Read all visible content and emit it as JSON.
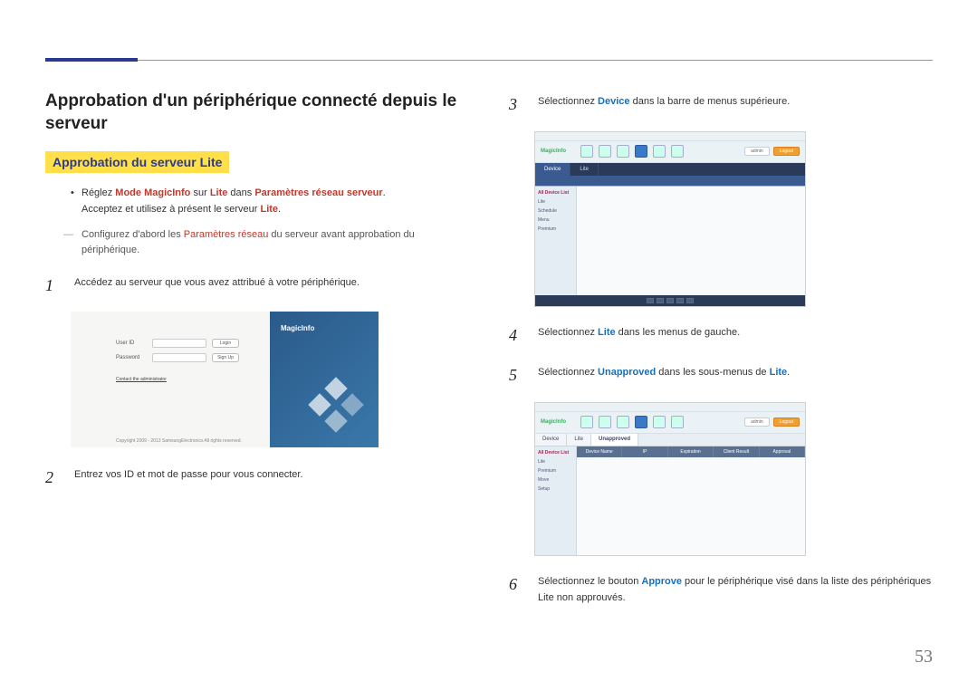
{
  "page_number": "53",
  "left": {
    "heading": "Approbation d'un périphérique connecté depuis le serveur",
    "sub_heading": "Approbation du serveur Lite",
    "bullet_pre": "Réglez ",
    "bullet_b1": "Mode MagicInfo",
    "bullet_mid1": " sur ",
    "bullet_b2": "Lite",
    "bullet_mid2": " dans ",
    "bullet_b3": "Paramètres réseau serveur",
    "bullet_post": ".",
    "bullet_line2a": "Acceptez et utilisez à présent le serveur ",
    "bullet_line2b": "Lite",
    "bullet_line2c": ".",
    "note_pre": "Configurez d'abord les ",
    "note_b": "Paramètres réseau",
    "note_post": " du serveur avant approbation du périphérique.",
    "step1": "Accédez au serveur que vous avez attribué à votre périphérique.",
    "step2": "Entrez vos ID et mot de passe pour vous connecter.",
    "login": {
      "user_id": "User ID",
      "password": "Password",
      "login_btn": "Login",
      "signup_btn": "Sign Up",
      "contact": "Contact the administrator",
      "brand": "MagicInfo",
      "copyright": "Copyright 2009 - 2013 SamsungElectronics  All rights reserved."
    }
  },
  "right": {
    "step3_pre": "Sélectionnez ",
    "step3_b": "Device",
    "step3_post": " dans la barre de menus supérieure.",
    "step4_pre": "Sélectionnez ",
    "step4_b": "Lite",
    "step4_post": " dans les menus de gauche.",
    "step5_pre": "Sélectionnez ",
    "step5_b": "Unapproved",
    "step5_post": " dans les sous-menus de ",
    "step5_b2": "Lite",
    "step5_post2": ".",
    "step6_pre": "Sélectionnez le bouton ",
    "step6_b": "Approve",
    "step6_post": " pour le périphérique visé dans la liste des périphériques Lite non approuvés.",
    "app": {
      "brand": "MagicInfo",
      "tabs_a": [
        "Device",
        "Lite"
      ],
      "tabs_b": [
        "Device",
        "Lite",
        "Unapproved"
      ],
      "side": [
        "All Device List",
        "Lite",
        "Schedule",
        "Menu",
        "Premium",
        "Move",
        "Setup"
      ],
      "grid_cols": [
        "Device Name",
        "IP",
        "Expiration",
        "Client Result",
        "Approval"
      ]
    }
  },
  "nums": {
    "n1": "1",
    "n2": "2",
    "n3": "3",
    "n4": "4",
    "n5": "5",
    "n6": "6"
  }
}
